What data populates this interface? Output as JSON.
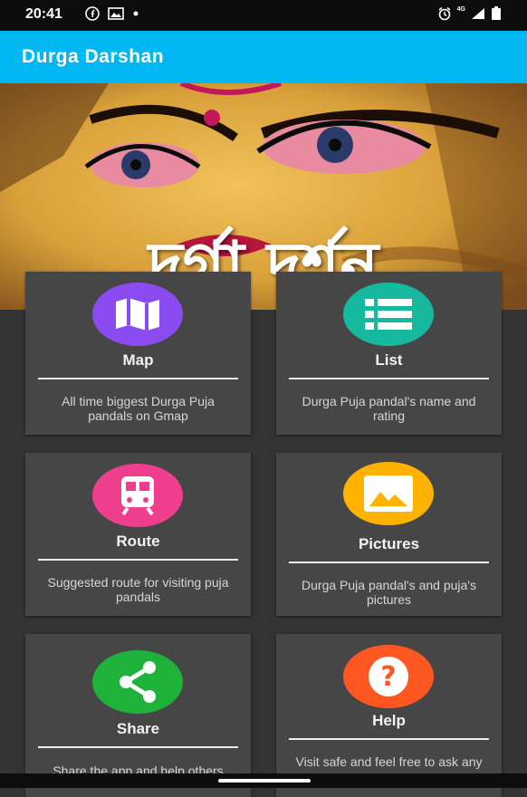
{
  "status_bar": {
    "time": "20:41",
    "network": "4G"
  },
  "app_bar": {
    "title": "Durga Darshan"
  },
  "banner": {
    "title": "দুর্গা দর্শন"
  },
  "cards": [
    {
      "title": "Map",
      "description": "All time biggest Durga Puja pandals on Gmap",
      "icon": "map-icon",
      "color": "#8a4cf0"
    },
    {
      "title": "List",
      "description": "Durga Puja pandal's name and rating",
      "icon": "list-icon",
      "color": "#17b99e"
    },
    {
      "title": "Route",
      "description": "Suggested route for visiting puja pandals",
      "icon": "train-icon",
      "color": "#ef3e8c"
    },
    {
      "title": "Pictures",
      "description": "Durga Puja pandal's and puja's pictures",
      "icon": "image-icon",
      "color": "#ffb300"
    },
    {
      "title": "Share",
      "description": "Share the app and help others",
      "icon": "share-icon",
      "color": "#1fb23a"
    },
    {
      "title": "Help",
      "description": "Visit safe and feel free to ask any query",
      "icon": "help-icon",
      "color": "#ff5722"
    }
  ]
}
